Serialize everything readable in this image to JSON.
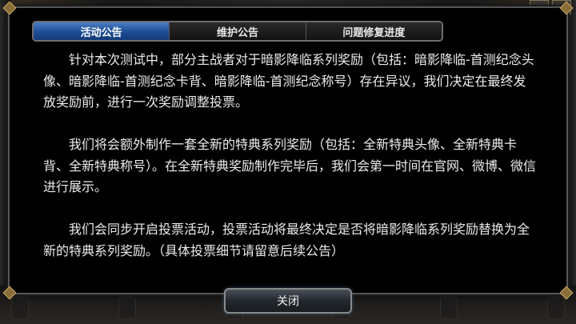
{
  "tabs": [
    {
      "label": "活动公告",
      "active": true
    },
    {
      "label": "维护公告",
      "active": false
    },
    {
      "label": "问题修复进度",
      "active": false
    }
  ],
  "content": {
    "paragraphs": [
      "针对本次测试中，部分主战者对于暗影降临系列奖励（包括：暗影降临-首测纪念头像、暗影降临-首测纪念卡背、暗影降临-首测纪念称号）存在异议，我们决定在最终发放奖励前，进行一次奖励调整投票。",
      "我们将会额外制作一套全新的特典系列奖励（包括：全新特典头像、全新特典卡背、全新特典称号）。在全新特典奖励制作完毕后，我们会第一时间在官网、微博、微信进行展示。",
      "我们会同步开启投票活动，投票活动将最终决定是否将暗影降临系列奖励替换为全新的特典系列奖励。（具体投票细节请留意后续公告）"
    ]
  },
  "footer": {
    "close_label": "关闭"
  },
  "colors": {
    "active_tab": "#1d4c94",
    "text": "#ececec",
    "dialog_bg": "#000000"
  }
}
